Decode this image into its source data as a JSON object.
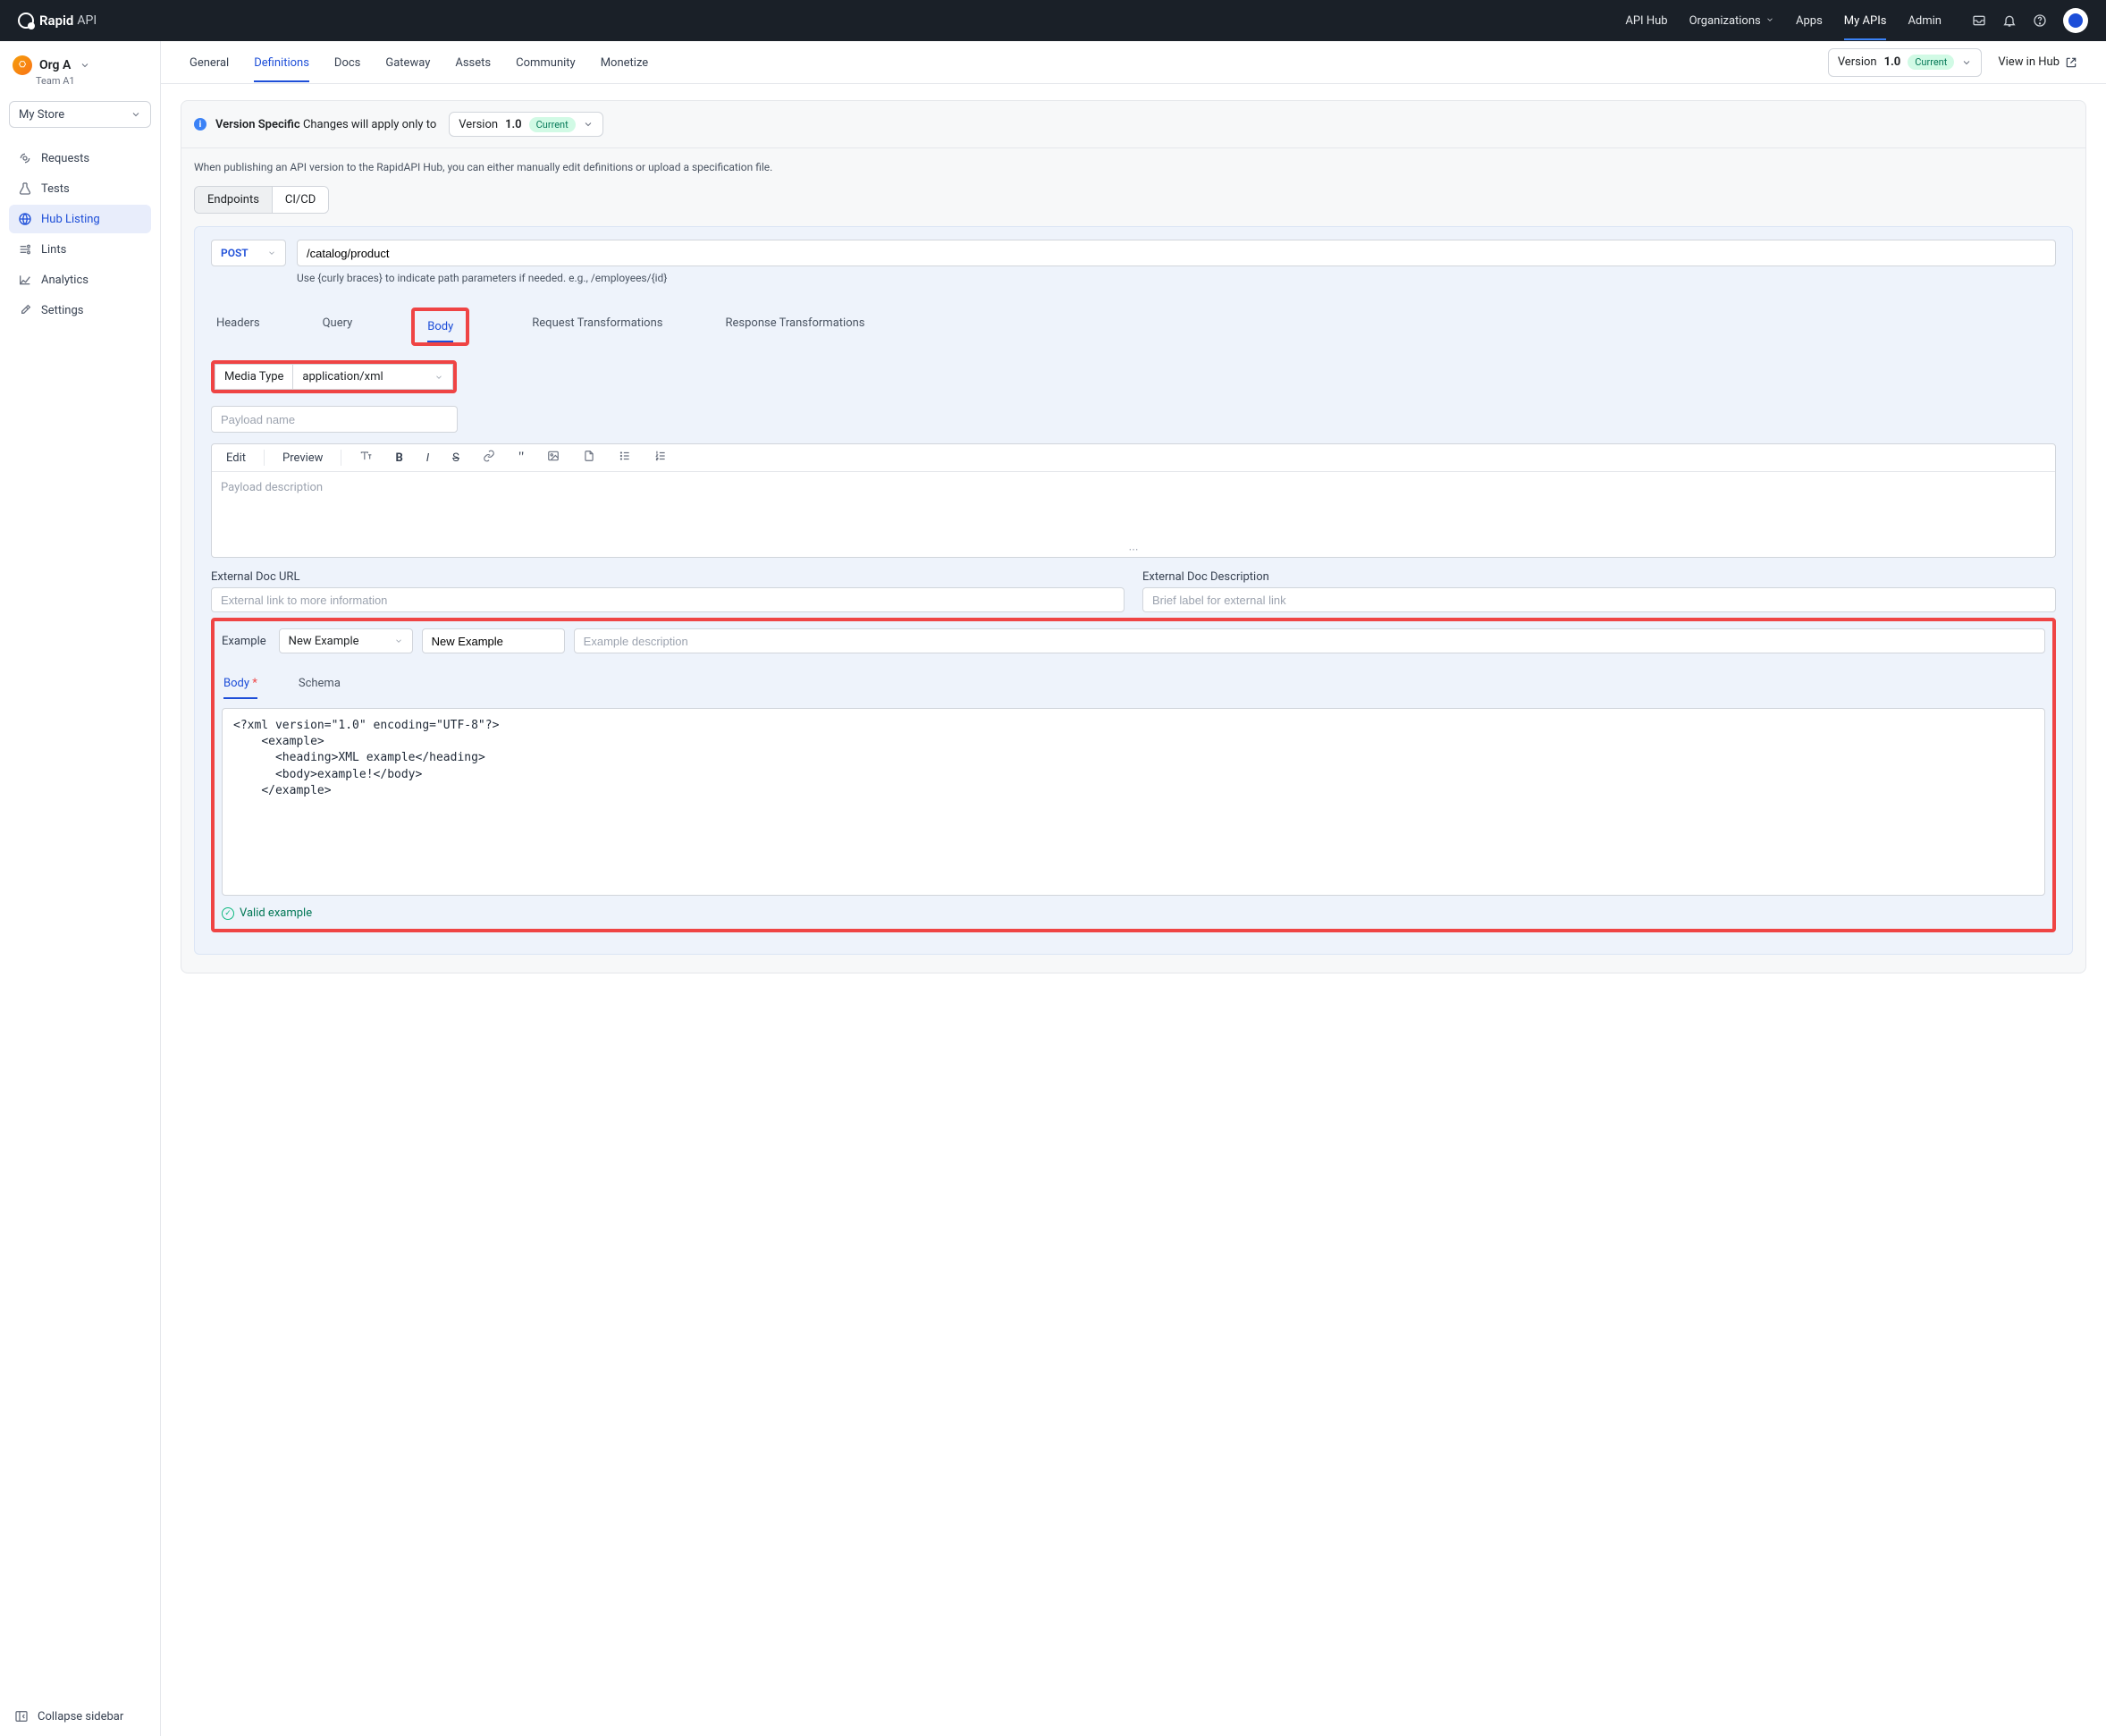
{
  "brand": {
    "name": "Rapid",
    "suffix": "API"
  },
  "topnav": {
    "api_hub": "API Hub",
    "organizations": "Organizations",
    "apps": "Apps",
    "my_apis": "My APIs",
    "admin": "Admin"
  },
  "org": {
    "name": "Org A",
    "team": "Team A1"
  },
  "store_selector": "My Store",
  "sidebar": {
    "items": [
      {
        "label": "Requests"
      },
      {
        "label": "Tests"
      },
      {
        "label": "Hub Listing"
      },
      {
        "label": "Lints"
      },
      {
        "label": "Analytics"
      },
      {
        "label": "Settings"
      }
    ],
    "collapse": "Collapse sidebar"
  },
  "tabs": {
    "general": "General",
    "definitions": "Definitions",
    "docs": "Docs",
    "gateway": "Gateway",
    "assets": "Assets",
    "community": "Community",
    "monetize": "Monetize"
  },
  "version_selector": {
    "prefix": "Version",
    "value": "1.0",
    "badge": "Current"
  },
  "view_in_hub": "View in Hub",
  "notice": {
    "strong": "Version Specific",
    "rest": "Changes will apply only to",
    "select_prefix": "Version",
    "select_value": "1.0",
    "select_badge": "Current"
  },
  "publish_hint": "When publishing an API version to the RapidAPI Hub, you can either manually edit definitions or upload a specification file.",
  "subtabs": {
    "endpoints": "Endpoints",
    "cicd": "CI/CD"
  },
  "endpoint": {
    "method": "POST",
    "path": "/catalog/product",
    "path_hint": "Use {curly braces} to indicate path parameters if needed. e.g., /employees/{id}"
  },
  "req_tabs": {
    "headers": "Headers",
    "query": "Query",
    "body": "Body",
    "req_trans": "Request Transformations",
    "res_trans": "Response Transformations"
  },
  "media": {
    "label": "Media Type",
    "value": "application/xml"
  },
  "payload": {
    "name_placeholder": "Payload name",
    "desc_placeholder": "Payload description"
  },
  "editor_toolbar": {
    "edit": "Edit",
    "preview": "Preview"
  },
  "ext": {
    "url_label": "External Doc URL",
    "url_placeholder": "External link to more information",
    "desc_label": "External Doc Description",
    "desc_placeholder": "Brief label for external link"
  },
  "example": {
    "label": "Example",
    "select_value": "New Example",
    "name_value": "New Example",
    "desc_placeholder": "Example description",
    "tabs": {
      "body": "Body",
      "schema": "Schema"
    },
    "code": "<?xml version=\"1.0\" encoding=\"UTF-8\"?>\n    <example>\n      <heading>XML example</heading>\n      <body>example!</body>\n    </example>",
    "valid": "Valid example"
  }
}
